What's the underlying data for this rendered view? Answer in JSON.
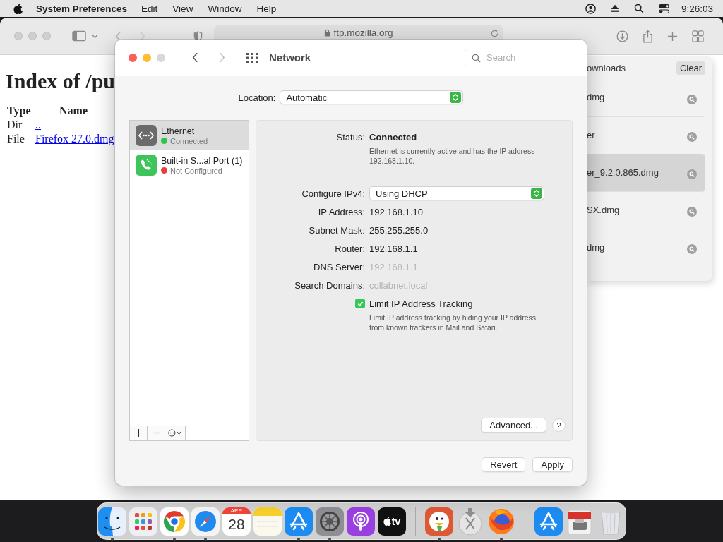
{
  "menu_bar": {
    "app_name": "System Preferences",
    "menus": [
      "Edit",
      "View",
      "Window",
      "Help"
    ],
    "clock": "9:26:03"
  },
  "browser": {
    "address": "ftp.mozilla.org",
    "heading": "Index of /pu",
    "columns": [
      "Type",
      "Name"
    ],
    "rows": [
      {
        "type": "Dir",
        "name": ".."
      },
      {
        "type": "File",
        "name": "Firefox 27.0.dmg"
      }
    ]
  },
  "downloads": {
    "title": "ownloads",
    "clear": "Clear",
    "items": [
      {
        "name": "dmg",
        "selected": false
      },
      {
        "name": "er",
        "selected": false
      },
      {
        "name": "er_9.2.0.865.dmg",
        "selected": true
      },
      {
        "name": "SX.dmg",
        "selected": false
      },
      {
        "name": "dmg",
        "selected": false
      }
    ]
  },
  "network": {
    "title": "Network",
    "search": {
      "placeholder": "Search"
    },
    "location": {
      "label": "Location:",
      "value": "Automatic"
    },
    "services": [
      {
        "kind": "ethernet",
        "name": "Ethernet",
        "status": "Connected",
        "color": "#30c548",
        "selected": true
      },
      {
        "kind": "phone",
        "name": "Built-in S...al Port (1)",
        "status": "Not Configured",
        "color": "#e8403a",
        "selected": false
      }
    ],
    "status": {
      "label": "Status:",
      "value": "Connected",
      "note": "Ethernet is currently active and has the IP address 192.168.1.10."
    },
    "configure": {
      "label": "Configure IPv4:",
      "value": "Using DHCP"
    },
    "fields": [
      {
        "label": "IP Address:",
        "value": "192.168.1.10",
        "disabled": false
      },
      {
        "label": "Subnet Mask:",
        "value": "255.255.255.0",
        "disabled": false
      },
      {
        "label": "Router:",
        "value": "192.168.1.1",
        "disabled": false
      },
      {
        "label": "DNS Server:",
        "value": "192.168.1.1",
        "disabled": true
      },
      {
        "label": "Search Domains:",
        "value": "collabnet.local",
        "disabled": true
      }
    ],
    "tracking": {
      "label": "Limit IP Address Tracking",
      "checked": true,
      "note": "Limit IP address tracking by hiding your IP address from known trackers in Mail and Safari."
    },
    "advanced": "Advanced...",
    "help": "?",
    "revert": "Revert",
    "apply": "Apply"
  },
  "dock": {
    "items": [
      {
        "kind": "finder",
        "running": true
      },
      {
        "kind": "launchpad",
        "running": false
      },
      {
        "kind": "chrome",
        "running": true
      },
      {
        "kind": "safari",
        "running": true
      },
      {
        "kind": "calendar",
        "month": "APR",
        "day": "28",
        "running": false
      },
      {
        "kind": "notes",
        "running": false
      },
      {
        "kind": "appstore",
        "running": true
      },
      {
        "kind": "settings",
        "running": true
      },
      {
        "kind": "podcasts",
        "running": false
      },
      {
        "kind": "tv",
        "label": "tv",
        "running": false
      },
      {
        "kind": "separator"
      },
      {
        "kind": "duck",
        "running": true
      },
      {
        "kind": "installer",
        "running": false
      },
      {
        "kind": "firefox",
        "running": true
      },
      {
        "kind": "separator"
      },
      {
        "kind": "appstore",
        "running": false
      },
      {
        "kind": "package",
        "running": false
      },
      {
        "kind": "trash",
        "running": false
      }
    ]
  }
}
